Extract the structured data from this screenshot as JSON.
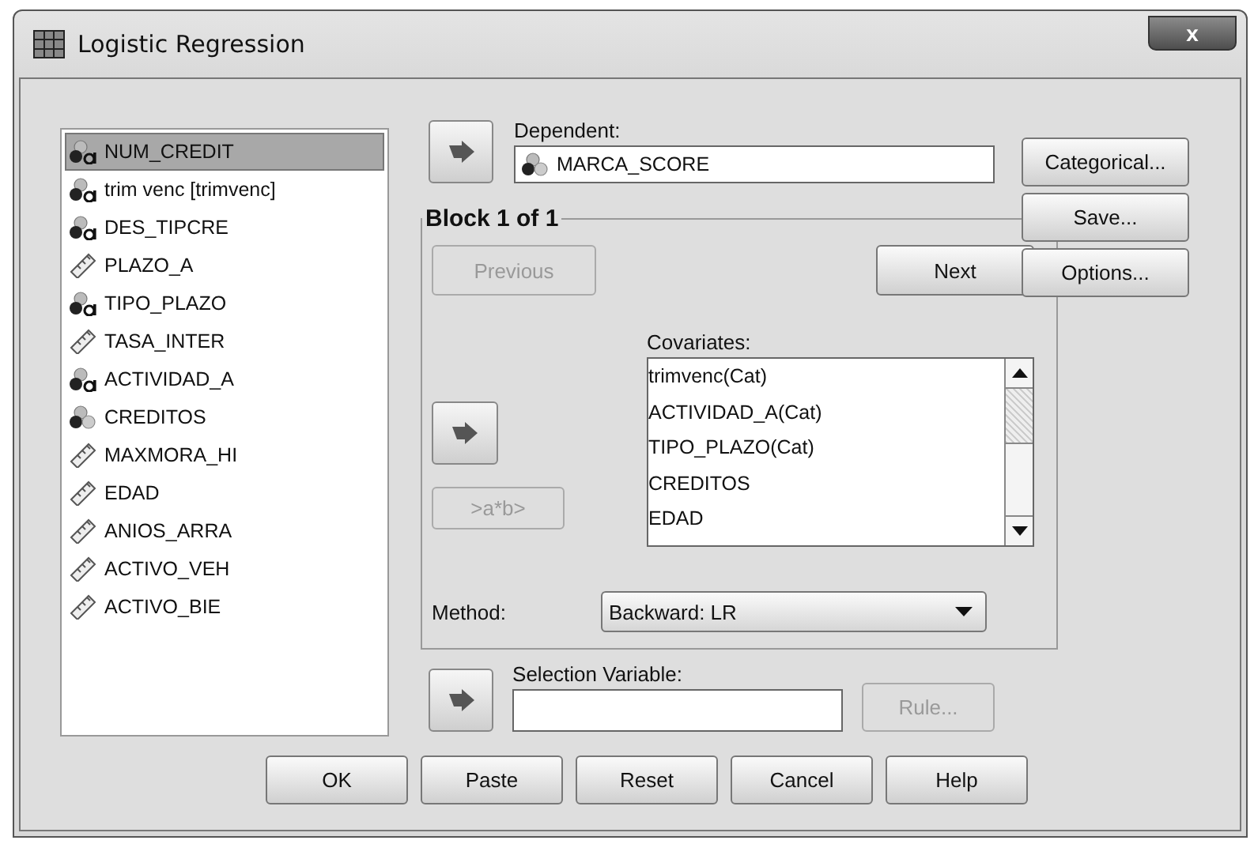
{
  "window": {
    "title": "Logistic Regression",
    "close": "x"
  },
  "variables": [
    {
      "name": "NUM_CREDIT",
      "kind": "nominal_string",
      "selected": true
    },
    {
      "name": "trim venc [trimvenc]",
      "kind": "nominal_string",
      "selected": false
    },
    {
      "name": "DES_TIPCRE",
      "kind": "nominal_string",
      "selected": false
    },
    {
      "name": "PLAZO_A",
      "kind": "scale",
      "selected": false
    },
    {
      "name": "TIPO_PLAZO",
      "kind": "nominal_string",
      "selected": false
    },
    {
      "name": "TASA_INTER",
      "kind": "scale",
      "selected": false
    },
    {
      "name": "ACTIVIDAD_A",
      "kind": "nominal_string",
      "selected": false
    },
    {
      "name": "CREDITOS",
      "kind": "nominal",
      "selected": false
    },
    {
      "name": "MAXMORA_HI",
      "kind": "scale",
      "selected": false
    },
    {
      "name": "EDAD",
      "kind": "scale",
      "selected": false
    },
    {
      "name": "ANIOS_ARRA",
      "kind": "scale",
      "selected": false
    },
    {
      "name": "ACTIVO_VEH",
      "kind": "scale",
      "selected": false
    },
    {
      "name": "ACTIVO_BIE",
      "kind": "scale",
      "selected": false
    }
  ],
  "dependent": {
    "label": "Dependent:",
    "value": "MARCA_SCORE",
    "kind": "nominal"
  },
  "block": {
    "title": "Block 1 of 1",
    "previous": {
      "label": "Previous",
      "disabled": true
    },
    "next": {
      "label": "Next",
      "disabled": false
    },
    "covariates_label": "Covariates:",
    "covariates": [
      "trimvenc(Cat)",
      "ACTIVIDAD_A(Cat)",
      "TIPO_PLAZO(Cat)",
      "CREDITOS",
      "EDAD"
    ],
    "interaction": {
      "label": ">a*b>",
      "disabled": true
    },
    "method_label": "Method:",
    "method": "Backward: LR"
  },
  "selection": {
    "label": "Selection Variable:",
    "rule": {
      "label": "Rule...",
      "disabled": true
    }
  },
  "side_buttons": [
    {
      "label": "Categorical...",
      "disabled": false
    },
    {
      "label": "Save...",
      "disabled": false
    },
    {
      "label": "Options...",
      "disabled": false
    }
  ],
  "bottom_buttons": [
    {
      "label": "OK",
      "disabled": false
    },
    {
      "label": "Paste",
      "disabled": false
    },
    {
      "label": "Reset",
      "disabled": false
    },
    {
      "label": "Cancel",
      "disabled": false
    },
    {
      "label": "Help",
      "disabled": false
    }
  ]
}
